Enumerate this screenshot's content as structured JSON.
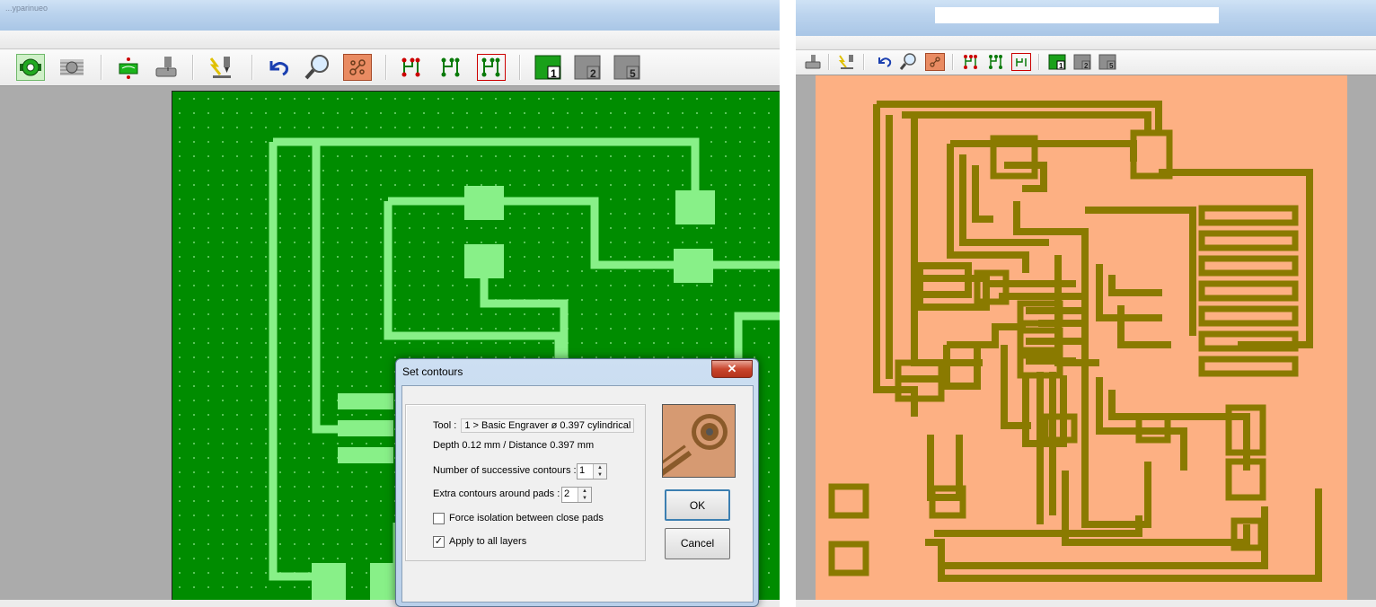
{
  "left_window": {
    "title": "...yparinueo",
    "toolbar": {
      "buttons": [
        {
          "name": "isolation-milling",
          "icon": "isolation-contour-icon",
          "active": true
        },
        {
          "name": "hatching",
          "icon": "hatch-fill-icon",
          "active": false
        },
        {
          "name": "drilling",
          "icon": "drill-pcb-icon",
          "active": false
        },
        {
          "name": "milling-machine",
          "icon": "milling-machine-icon",
          "active": false
        },
        {
          "name": "engraver",
          "icon": "engraver-icon",
          "active": false
        },
        {
          "name": "undo",
          "icon": "undo-icon",
          "active": false
        },
        {
          "name": "zoom",
          "icon": "magnifier-icon",
          "active": false
        },
        {
          "name": "board-view",
          "icon": "board-view-icon",
          "active": false
        },
        {
          "name": "tracks-1",
          "icon": "tracks-icon",
          "active": false
        },
        {
          "name": "tracks-2",
          "icon": "tracks-icon",
          "active": false
        },
        {
          "name": "tracks-3",
          "icon": "tracks-selected-icon",
          "active": false
        },
        {
          "name": "layer-1",
          "icon": "layer-icon",
          "label": "1",
          "active": true
        },
        {
          "name": "layer-2",
          "icon": "layer-icon",
          "label": "2",
          "active": false
        },
        {
          "name": "layer-5",
          "icon": "layer-icon",
          "label": "5",
          "active": false
        }
      ]
    }
  },
  "right_window": {
    "toolbar": {
      "buttons": [
        {
          "name": "milling-machine",
          "icon": "milling-machine-icon"
        },
        {
          "name": "engraver",
          "icon": "engraver-icon"
        },
        {
          "name": "undo",
          "icon": "undo-icon"
        },
        {
          "name": "zoom",
          "icon": "magnifier-icon"
        },
        {
          "name": "board-view",
          "icon": "board-view-icon"
        },
        {
          "name": "tracks-1",
          "icon": "tracks-icon"
        },
        {
          "name": "tracks-2",
          "icon": "tracks-icon"
        },
        {
          "name": "tracks-3",
          "icon": "tracks-selected-icon"
        },
        {
          "name": "layer-1",
          "icon": "layer-icon",
          "label": "1"
        },
        {
          "name": "layer-2",
          "icon": "layer-icon",
          "label": "2"
        },
        {
          "name": "layer-5",
          "icon": "layer-icon",
          "label": "5"
        }
      ]
    }
  },
  "dialog": {
    "title": "Set contours",
    "close_label": "✕",
    "tool_label": "Tool :",
    "tool_value": "1 > Basic Engraver   ø 0.397   cylindrical",
    "depth_text": "Depth 0.12 mm  /  Distance 0.397 mm",
    "successive_label": "Number of successive contours :",
    "successive_value": "1",
    "extra_label": "Extra contours around pads :",
    "extra_value": "2",
    "force_label": "Force isolation between close pads",
    "force_checked": false,
    "apply_label": "Apply to all layers",
    "apply_checked": true,
    "ok_label": "OK",
    "cancel_label": "Cancel"
  },
  "colors": {
    "pcb_green": "#008c00",
    "track_green": "#88f088",
    "board_orange": "#fdb083",
    "track_olive": "#8a7a00"
  }
}
